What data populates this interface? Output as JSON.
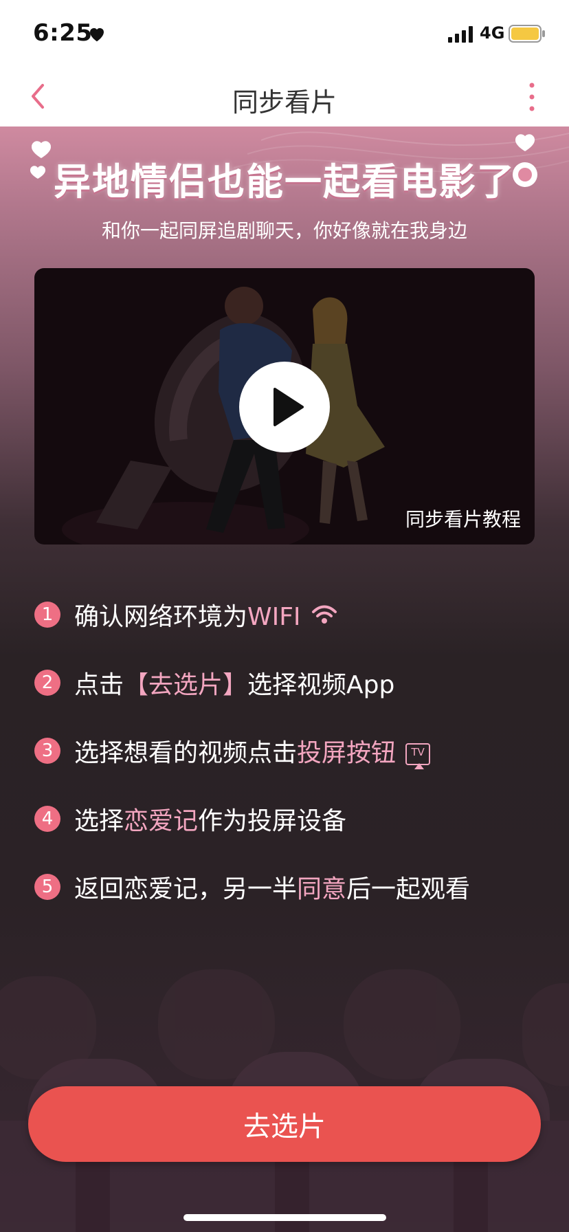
{
  "status_bar": {
    "time": "6:25",
    "network": "4G",
    "battery_color": "#f5c842"
  },
  "nav": {
    "title": "同步看片"
  },
  "hero": {
    "title": "异地情侣也能一起看电影了",
    "subtitle": "和你一起同屏追剧聊天，你好像就在我身边"
  },
  "video": {
    "caption": "同步看片教程"
  },
  "steps": [
    {
      "num": "1",
      "parts": [
        {
          "t": "确认网络环境为",
          "hl": false
        },
        {
          "t": "WIFI",
          "hl": true
        }
      ],
      "icon": "wifi-icon"
    },
    {
      "num": "2",
      "parts": [
        {
          "t": "点击",
          "hl": false
        },
        {
          "t": "【去选片】",
          "hl": true
        },
        {
          "t": "选择视频App",
          "hl": false
        }
      ],
      "icon": null
    },
    {
      "num": "3",
      "parts": [
        {
          "t": "选择想看的视频点击",
          "hl": false
        },
        {
          "t": "投屏按钮",
          "hl": true
        }
      ],
      "icon": "cast-tv-icon",
      "icon_label": "TV"
    },
    {
      "num": "4",
      "parts": [
        {
          "t": "选择",
          "hl": false
        },
        {
          "t": "恋爱记",
          "hl": true
        },
        {
          "t": "作为投屏设备",
          "hl": false
        }
      ],
      "icon": null
    },
    {
      "num": "5",
      "parts": [
        {
          "t": "返回恋爱记，另一半",
          "hl": false
        },
        {
          "t": "同意",
          "hl": true
        },
        {
          "t": "后一起观看",
          "hl": false
        }
      ],
      "icon": null
    }
  ],
  "cta": {
    "label": "去选片"
  },
  "colors": {
    "accent": "#ea5350",
    "highlight": "#f3a6c0",
    "step_badge": "#ee6f84",
    "back_arrow": "#e86d8a"
  }
}
